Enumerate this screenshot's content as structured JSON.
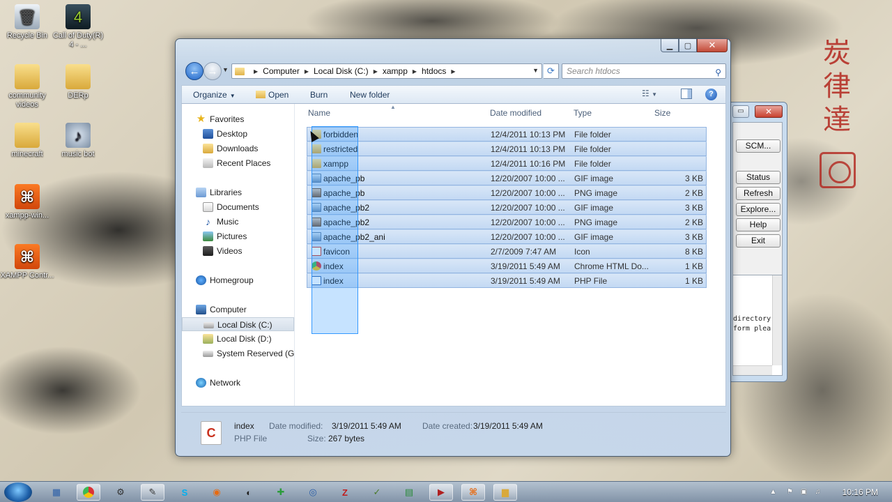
{
  "desktop": {
    "icons": [
      {
        "label": "Recycle Bin",
        "icon": "recycle-bin-icon",
        "glyph": "🗑"
      },
      {
        "label": "Call of Duty(R) 4 - ...",
        "icon": "game-shortcut-icon",
        "glyph": "4"
      },
      {
        "label": "community videos",
        "icon": "folder-icon",
        "glyph": ""
      },
      {
        "label": "DERp",
        "icon": "folder-icon",
        "glyph": ""
      },
      {
        "label": "minecraft",
        "icon": "folder-icon",
        "glyph": ""
      },
      {
        "label": "music bot",
        "icon": "music-icon",
        "glyph": "♪"
      },
      {
        "label": "xampp-win...",
        "icon": "xampp-icon",
        "glyph": "⌘"
      },
      {
        "label": "XAMPP Contr...",
        "icon": "xampp-control-icon",
        "glyph": "⌘"
      }
    ]
  },
  "xampp_panel": {
    "buttons": [
      "SCM...",
      "Status",
      "Refresh",
      "Explore...",
      "Help",
      "Exit"
    ],
    "log_lines": [
      "directory",
      "form plea"
    ]
  },
  "window": {
    "address": {
      "crumbs": [
        "Computer",
        "Local Disk (C:)",
        "xampp",
        "htdocs"
      ]
    },
    "search": {
      "placeholder": "Search htdocs"
    },
    "toolbar": {
      "organize": "Organize",
      "open": "Open",
      "burn": "Burn",
      "new_folder": "New folder"
    },
    "nav_pane": {
      "favorites": "Favorites",
      "desktop": "Desktop",
      "downloads": "Downloads",
      "recent_places": "Recent Places",
      "libraries": "Libraries",
      "documents": "Documents",
      "music": "Music",
      "pictures": "Pictures",
      "videos": "Videos",
      "homegroup": "Homegroup",
      "computer": "Computer",
      "local_disk_c": "Local Disk (C:)",
      "local_disk_d": "Local Disk (D:)",
      "system_reserved": "System Reserved (G:)",
      "network": "Network"
    },
    "columns": {
      "name": "Name",
      "date_modified": "Date modified",
      "type": "Type",
      "size": "Size"
    },
    "files": [
      {
        "name": "forbidden",
        "date": "12/4/2011 10:13 PM",
        "type": "File folder",
        "size": "",
        "kind": "folder"
      },
      {
        "name": "restricted",
        "date": "12/4/2011 10:13 PM",
        "type": "File folder",
        "size": "",
        "kind": "folder"
      },
      {
        "name": "xampp",
        "date": "12/4/2011 10:16 PM",
        "type": "File folder",
        "size": "",
        "kind": "folder"
      },
      {
        "name": "apache_pb",
        "date": "12/20/2007 10:00 ...",
        "type": "GIF image",
        "size": "3 KB",
        "kind": "gif"
      },
      {
        "name": "apache_pb",
        "date": "12/20/2007 10:00 ...",
        "type": "PNG image",
        "size": "2 KB",
        "kind": "png"
      },
      {
        "name": "apache_pb2",
        "date": "12/20/2007 10:00 ...",
        "type": "GIF image",
        "size": "3 KB",
        "kind": "gif"
      },
      {
        "name": "apache_pb2",
        "date": "12/20/2007 10:00 ...",
        "type": "PNG image",
        "size": "2 KB",
        "kind": "png"
      },
      {
        "name": "apache_pb2_ani",
        "date": "12/20/2007 10:00 ...",
        "type": "GIF image",
        "size": "3 KB",
        "kind": "gif"
      },
      {
        "name": "favicon",
        "date": "2/7/2009 7:47 AM",
        "type": "Icon",
        "size": "8 KB",
        "kind": "ico"
      },
      {
        "name": "index",
        "date": "3/19/2011 5:49 AM",
        "type": "Chrome HTML Do...",
        "size": "1 KB",
        "kind": "chrome"
      },
      {
        "name": "index",
        "date": "3/19/2011 5:49 AM",
        "type": "PHP File",
        "size": "1 KB",
        "kind": "php"
      }
    ],
    "details": {
      "name": "index",
      "type": "PHP File",
      "modified_label": "Date modified:",
      "modified_value": "3/19/2011 5:49 AM",
      "created_label": "Date created:",
      "created_value": "3/19/2011 5:49 AM",
      "size_label": "Size:",
      "size_value": "267 bytes"
    }
  },
  "taskbar": {
    "clock": "10:16 PM"
  },
  "colors": {
    "selection": "#c3d9f3",
    "selection_border": "#92b4e0",
    "marquee": "#3399ff",
    "accent": "#1f4f9a"
  }
}
